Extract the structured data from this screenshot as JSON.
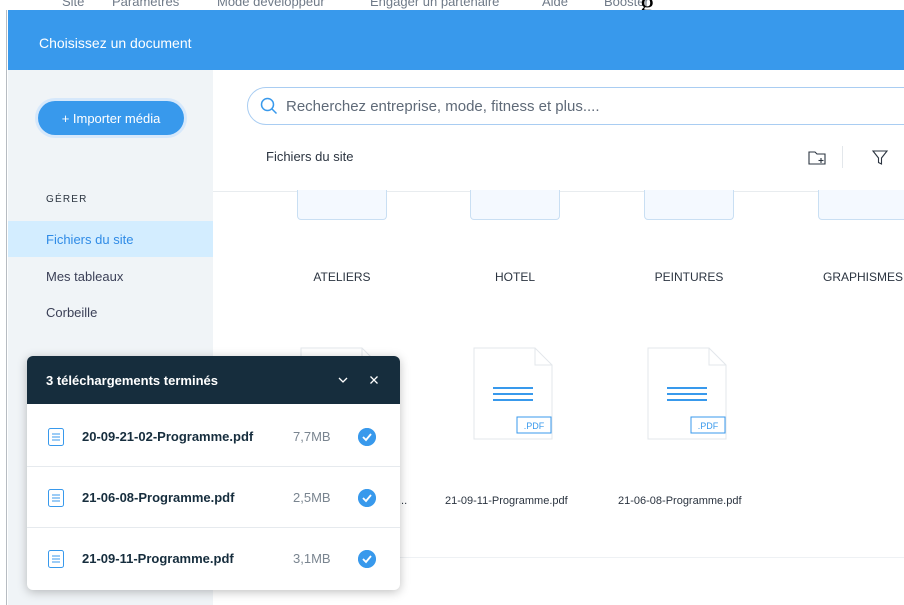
{
  "background_menu": {
    "items": [
      "Site",
      "Paramètres",
      "Mode développeur",
      "Engager un partenaire",
      "Aide",
      "Booster"
    ],
    "fragment": "g"
  },
  "modal": {
    "title": "Choisissez un document"
  },
  "sidebar": {
    "import_label": "+ Importer média",
    "section_label": "GÉRER",
    "items": [
      {
        "label": "Fichiers du site",
        "active": true
      },
      {
        "label": "Mes tableaux",
        "active": false
      },
      {
        "label": "Corbeille",
        "active": false
      }
    ]
  },
  "search": {
    "placeholder": "Recherchez entreprise, mode, fitness et plus...."
  },
  "breadcrumb": "Fichiers du site",
  "toolbar": {
    "icons": [
      "new-folder-icon",
      "filter-icon"
    ]
  },
  "folders": [
    {
      "label": "ATELIERS"
    },
    {
      "label": "HOTEL"
    },
    {
      "label": "PEINTURES"
    },
    {
      "label": "GRAPHISMES"
    }
  ],
  "documents": [
    {
      "name": "...",
      "badge": ".PDF"
    },
    {
      "name": "21-09-11-Programme.pdf",
      "badge": ".PDF"
    },
    {
      "name": "21-06-08-Programme.pdf",
      "badge": ".PDF"
    }
  ],
  "downloads": {
    "title": "3 téléchargements terminés",
    "items": [
      {
        "name": "20-09-21-02-Programme.pdf",
        "size": "7,7MB"
      },
      {
        "name": "21-06-08-Programme.pdf",
        "size": "2,5MB"
      },
      {
        "name": "21-09-11-Programme.pdf",
        "size": "3,1MB"
      }
    ]
  },
  "colors": {
    "header_blue": "#3899ec",
    "sidebar_bg": "#f0f4f7",
    "active_item_bg": "#d3edff",
    "panel_header": "#162d3d"
  }
}
